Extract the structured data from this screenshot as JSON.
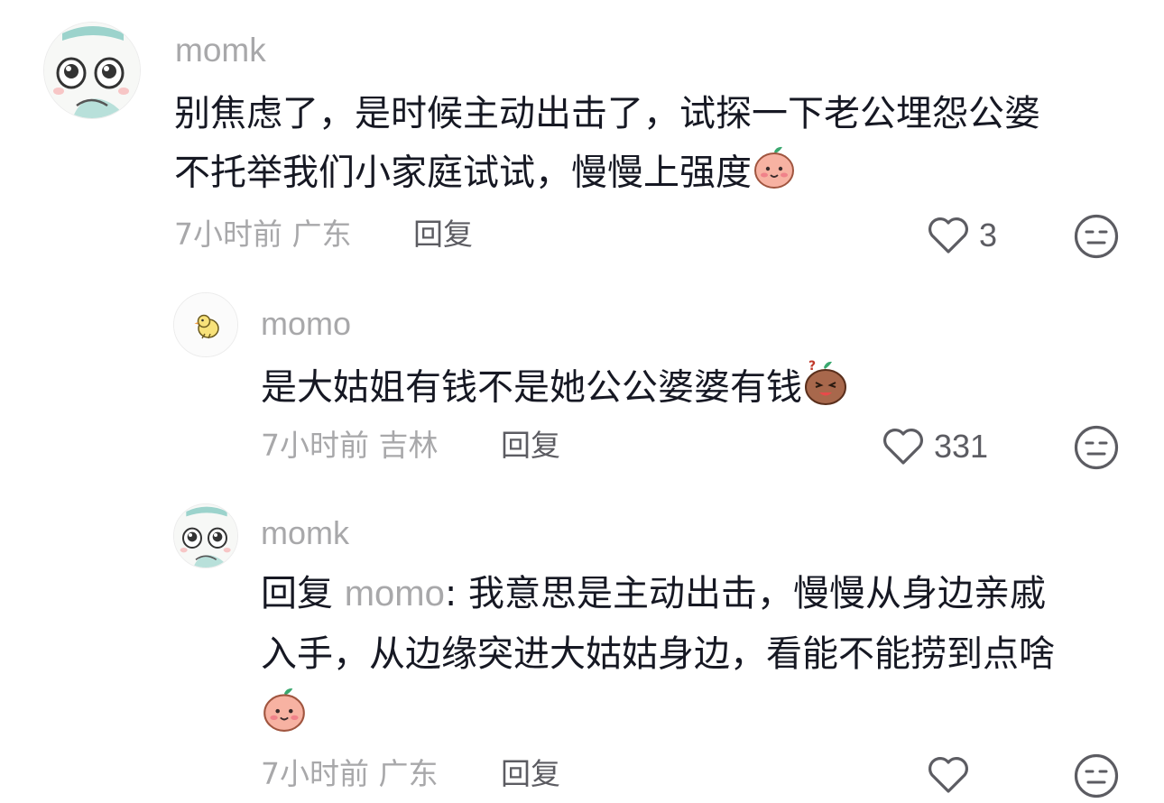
{
  "comments": [
    {
      "username": "momk",
      "lines": [
        "别焦虑了，是时候主动出击了，试探一下老公埋怨公婆",
        "不托举我们小家庭试试，慢慢上强度"
      ],
      "emoji": "peach-smile-emoji",
      "time": "7小时前",
      "location": "广东",
      "reply_label": "回复",
      "like_count": "3",
      "avatar_icon": "cartoon-bunny-avatar"
    },
    {
      "username": "momo",
      "lines": [
        "是大姑姐有钱不是她公公婆婆有钱"
      ],
      "emoji": "brown-grin-emoji",
      "time": "7小时前",
      "location": "吉林",
      "reply_label": "回复",
      "like_count": "331",
      "avatar_icon": "yellow-chick-avatar"
    },
    {
      "username": "momk",
      "reply_prefix": "回复",
      "reply_to": "momo",
      "reply_text_first": ": 我意思是主动出击，慢慢从身边亲戚",
      "lines": [
        "入手，从边缘突进大姑姑身边，看能不能捞到点啥"
      ],
      "emoji": "peach-smile-emoji",
      "time": "7小时前",
      "location": "广东",
      "reply_label": "回复",
      "like_count": "",
      "avatar_icon": "cartoon-bunny-avatar"
    }
  ],
  "icons": {
    "like": "heart-outline-icon",
    "dislike": "meh-face-icon"
  },
  "colors": {
    "text": "#161823",
    "muted": "#a8a8aa",
    "action": "#5c5c62"
  }
}
